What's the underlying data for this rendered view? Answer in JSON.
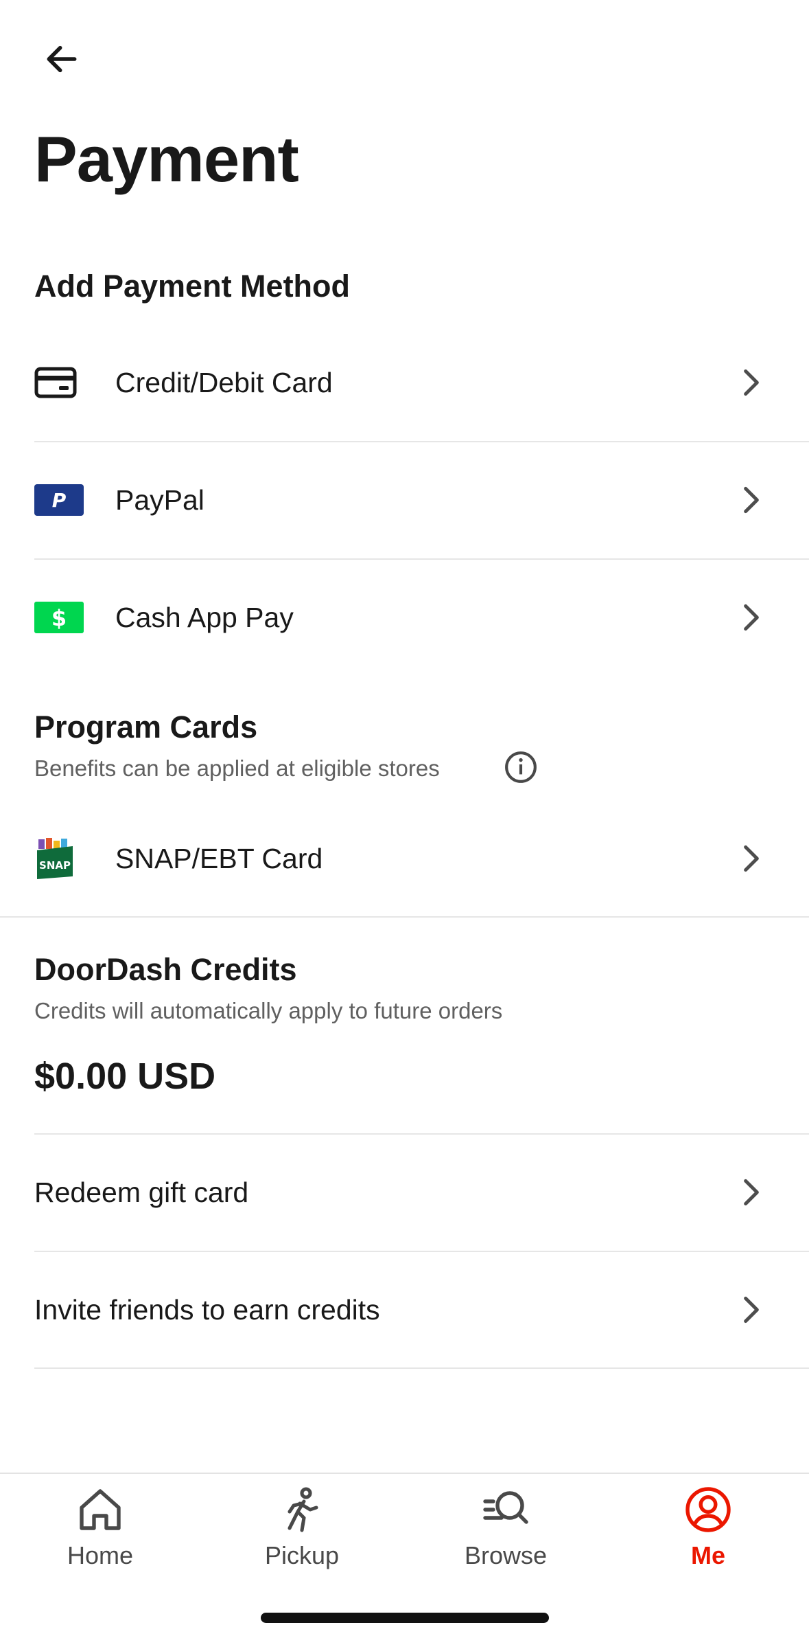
{
  "header": {
    "title": "Payment",
    "back_icon": "arrow-left-icon"
  },
  "add_payment": {
    "heading": "Add Payment Method",
    "items": [
      {
        "label": "Credit/Debit Card",
        "icon": "credit-card-icon"
      },
      {
        "label": "PayPal",
        "icon": "paypal-icon"
      },
      {
        "label": "Cash App Pay",
        "icon": "cash-app-icon"
      }
    ]
  },
  "program_cards": {
    "heading": "Program Cards",
    "subtext": "Benefits can be applied at eligible stores",
    "info_icon": "info-icon",
    "items": [
      {
        "label": "SNAP/EBT Card",
        "icon": "snap-ebt-icon",
        "logo_text": "SNAP"
      }
    ]
  },
  "credits": {
    "heading": "DoorDash Credits",
    "subtext": "Credits will automatically apply to future orders",
    "balance": "$0.00 USD",
    "items": [
      {
        "label": "Redeem gift card"
      },
      {
        "label": "Invite friends to earn credits"
      }
    ]
  },
  "tabbar": {
    "tabs": [
      {
        "label": "Home",
        "icon": "home-icon",
        "active": false
      },
      {
        "label": "Pickup",
        "icon": "walking-person-icon",
        "active": false
      },
      {
        "label": "Browse",
        "icon": "browse-search-icon",
        "active": false
      },
      {
        "label": "Me",
        "icon": "user-profile-icon",
        "active": true
      }
    ]
  },
  "colors": {
    "accent": "#eb1700",
    "paypal": "#1d3a8a",
    "cashapp": "#00d64f",
    "text": "#191919"
  }
}
